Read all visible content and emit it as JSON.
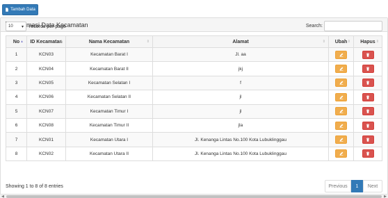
{
  "toolbar": {
    "add_label": "Tambah Data"
  },
  "panel": {
    "title": "Informasi Data Kecamatan"
  },
  "length": {
    "value": "10",
    "suffix": "records per page"
  },
  "search": {
    "label": "Search:",
    "value": ""
  },
  "table": {
    "headers": [
      "No",
      "ID Kecamatan",
      "Nama Kecamatan",
      "Alamat",
      "Ubah",
      "Hapus"
    ],
    "rows": [
      {
        "no": "1",
        "id": "KCN03",
        "nama": "Kecamatan Barat I",
        "alamat": "Jl. aa"
      },
      {
        "no": "2",
        "id": "KCN04",
        "nama": "Kecamatan Barat II",
        "alamat": "jkj"
      },
      {
        "no": "3",
        "id": "KCN05",
        "nama": "Kecamatan Selatan I",
        "alamat": "f"
      },
      {
        "no": "4",
        "id": "KCN06",
        "nama": "Kecamatan Selatan II",
        "alamat": "jl"
      },
      {
        "no": "5",
        "id": "KCN07",
        "nama": "Kecamatan Timur I",
        "alamat": "jl"
      },
      {
        "no": "6",
        "id": "KCN08",
        "nama": "Kecamatan Timur II",
        "alamat": "jla"
      },
      {
        "no": "7",
        "id": "KCN01",
        "nama": "Kecamatan Utara I",
        "alamat": "Jl. Kenanga Lintas No.100 Kota Lubuklinggau"
      },
      {
        "no": "8",
        "id": "KCN02",
        "nama": "Kecamatan Utara II",
        "alamat": "Jl. Kenanga Lintas No.100 Kota Lubuklinggau"
      }
    ]
  },
  "footer": {
    "info": "Showing 1 to 8 of 8 entries"
  },
  "pagination": {
    "previous": "Previous",
    "current": "1",
    "next": "Next"
  },
  "colors": {
    "primary": "#337ab7",
    "warning": "#f0ad4e",
    "danger": "#d9534f"
  },
  "icons": {
    "add": "file-icon",
    "panel": "table-icon",
    "edit": "pencil-icon",
    "delete": "trash-icon"
  }
}
